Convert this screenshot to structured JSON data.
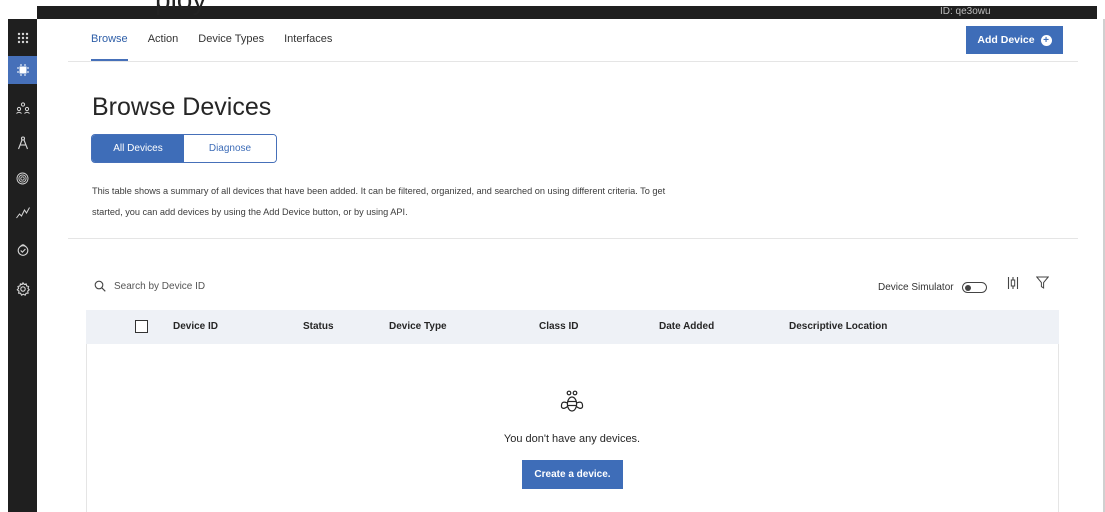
{
  "topbar": {
    "truncated_text": "ploy",
    "account_id": "ID: qe3owu"
  },
  "sidebar": {
    "items": [
      {
        "icon": "apps-grid-icon",
        "glyph": "⁝⁝⁝"
      },
      {
        "icon": "chip-icon",
        "glyph": "✹",
        "active": true
      },
      {
        "icon": "members-icon",
        "glyph": "∷"
      },
      {
        "icon": "compass-icon",
        "glyph": "∆"
      },
      {
        "icon": "fingerprint-icon",
        "glyph": "֎"
      },
      {
        "icon": "analytics-icon",
        "glyph": "↗"
      },
      {
        "icon": "security-icon",
        "glyph": "♁"
      },
      {
        "icon": "settings-icon",
        "glyph": "⚙"
      }
    ]
  },
  "tabs": [
    {
      "label": "Browse",
      "active": true
    },
    {
      "label": "Action",
      "active": false
    },
    {
      "label": "Device Types",
      "active": false
    },
    {
      "label": "Interfaces",
      "active": false
    }
  ],
  "header": {
    "add_device_label": "Add Device"
  },
  "page": {
    "title": "Browse Devices",
    "segments": {
      "all": "All Devices",
      "diagnose": "Diagnose"
    },
    "description": "This table shows a summary of all devices that have been added. It can be filtered, organized, and searched on using different criteria. To get started, you can add devices by using the Add Device button, or by using API."
  },
  "toolbar": {
    "search_placeholder": "Search by Device ID",
    "simulator_label": "Device Simulator",
    "simulator_on": false
  },
  "table": {
    "columns": [
      "Device ID",
      "Status",
      "Device Type",
      "Class ID",
      "Date Added",
      "Descriptive Location"
    ],
    "rows": []
  },
  "empty_state": {
    "icon": "bee-icon",
    "message": "You don't have any devices.",
    "cta_label": "Create a device."
  },
  "colors": {
    "primary": "#3e6db8",
    "sidebar": "#1f1f1f",
    "header_row": "#eef1f6"
  }
}
